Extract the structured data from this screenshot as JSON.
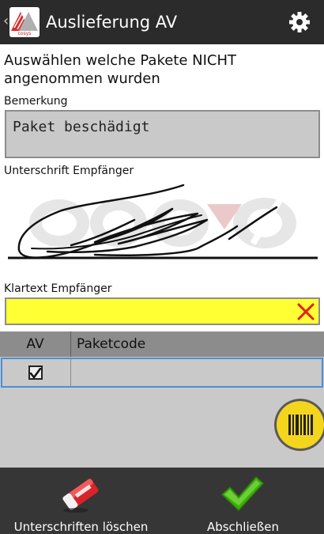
{
  "appbar": {
    "title": "Auslieferung AV",
    "logo_icon": "cosys-logo-icon",
    "settings_icon": "gear-icon",
    "back_icon": "chevron-left-icon"
  },
  "heading": "Auswählen welche Pakete NICHT angenommen wurden",
  "remark": {
    "label": "Bemerkung",
    "value": "Paket beschädigt"
  },
  "signature": {
    "label": "Unterschrift Empfänger"
  },
  "klartext": {
    "label": "Klartext Empfänger",
    "value": "",
    "clear_icon": "close-icon"
  },
  "table": {
    "columns": [
      "AV",
      "Paketcode"
    ],
    "rows": [
      {
        "av_checked": true,
        "paketcode": ""
      }
    ]
  },
  "scan_icon": "barcode-icon",
  "bottom": {
    "clear_label": "Unterschriften löschen",
    "clear_icon": "eraser-icon",
    "finish_label": "Abschließen",
    "finish_icon": "checkmark-icon"
  },
  "colors": {
    "appbar": "#2b2b2b",
    "field_bg": "#c9c9c9",
    "highlight_field": "#ffff34",
    "selected_row_border": "#4c8fd6",
    "scan_button": "#f3d51d",
    "accept": "#4fbf1f",
    "clear_x": "#e0201c"
  }
}
